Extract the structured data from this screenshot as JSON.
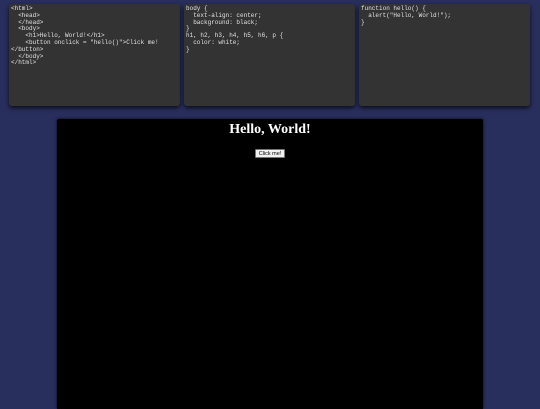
{
  "editors": {
    "html": {
      "lines": [
        "<html>",
        "  <head>",
        "  </head>",
        "  <body>",
        "    <h1>Hello, World!</h1>",
        "    <button onclick = \"hello()\">Click me!",
        "</button>",
        "  </body>",
        "</html>"
      ]
    },
    "css": {
      "lines": [
        "body {",
        "  text-align: center;",
        "  background: black;",
        "}",
        "h1, h2, h3, h4, h5, h6, p {",
        "  color: white;",
        "}"
      ]
    },
    "js": {
      "lines": [
        "function hello() {",
        "  alert(\"Hello, World!\");",
        "}"
      ]
    }
  },
  "preview": {
    "heading": "Hello, World!",
    "button_label": "Click me!",
    "background": "#000000",
    "heading_color": "#ffffff"
  },
  "theme": {
    "page_background": "#292f5d",
    "editor_background": "#333333",
    "code_color": "#e2e2e2"
  }
}
